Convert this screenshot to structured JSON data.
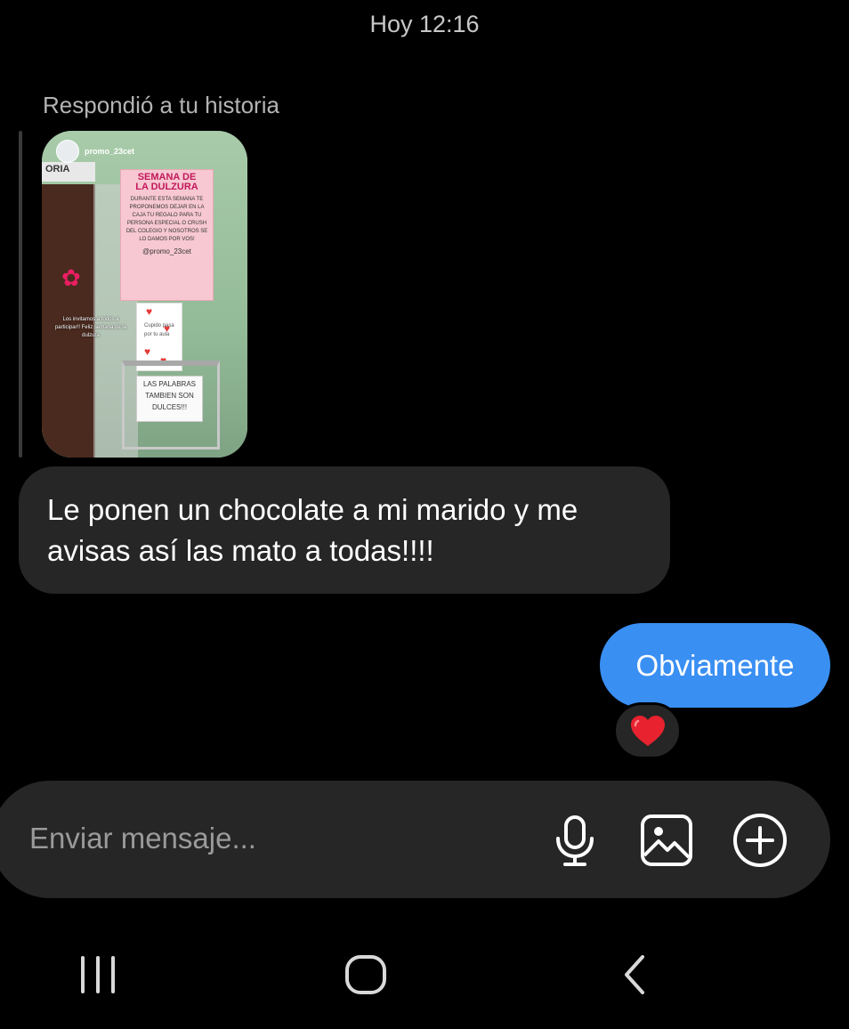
{
  "conversation": {
    "timestamp": "Hoy 12:16",
    "story_reply": {
      "label": "Respondió a tu historia",
      "story": {
        "username": "promo_23cet",
        "door_sign": "ORIA",
        "poster_title_line1": "SEMANA DE",
        "poster_title_line2": "LA DULZURA",
        "poster_text": "DURANTE ESTA SEMANA TE PROPONEMOS DEJAR EN LA CAJA TU REGALO PARA TU PERSONA ESPECIAL O CRUSH DEL COLEGIO Y NOSOTROS SE LO DAMOS POR VOS!",
        "poster_handle": "@promo_23cet",
        "box_text": "Cupido pasa por tu aula",
        "note_text": "LAS PALABRAS TAMBIEN SON DULCES!!!",
        "caption": "Los invitamos a todos a participar!! Feliz semana de la dulzura"
      }
    },
    "messages": [
      {
        "direction": "incoming",
        "text": "Le ponen un chocolate a mi marido y me avisas así las mato a todas!!!!"
      },
      {
        "direction": "outgoing",
        "text": "Obviamente",
        "reaction": "❤️"
      }
    ]
  },
  "composer": {
    "placeholder": "Enviar mensaje...",
    "icons": [
      "microphone-icon",
      "gallery-icon",
      "add-icon"
    ]
  },
  "navigation_bar": {
    "icons": [
      "recent-apps-icon",
      "home-icon",
      "back-icon"
    ]
  },
  "colors": {
    "background": "#000000",
    "incoming_bubble": "#262626",
    "outgoing_bubble": "#3a8ff3",
    "placeholder_text": "#9a9a9a"
  }
}
